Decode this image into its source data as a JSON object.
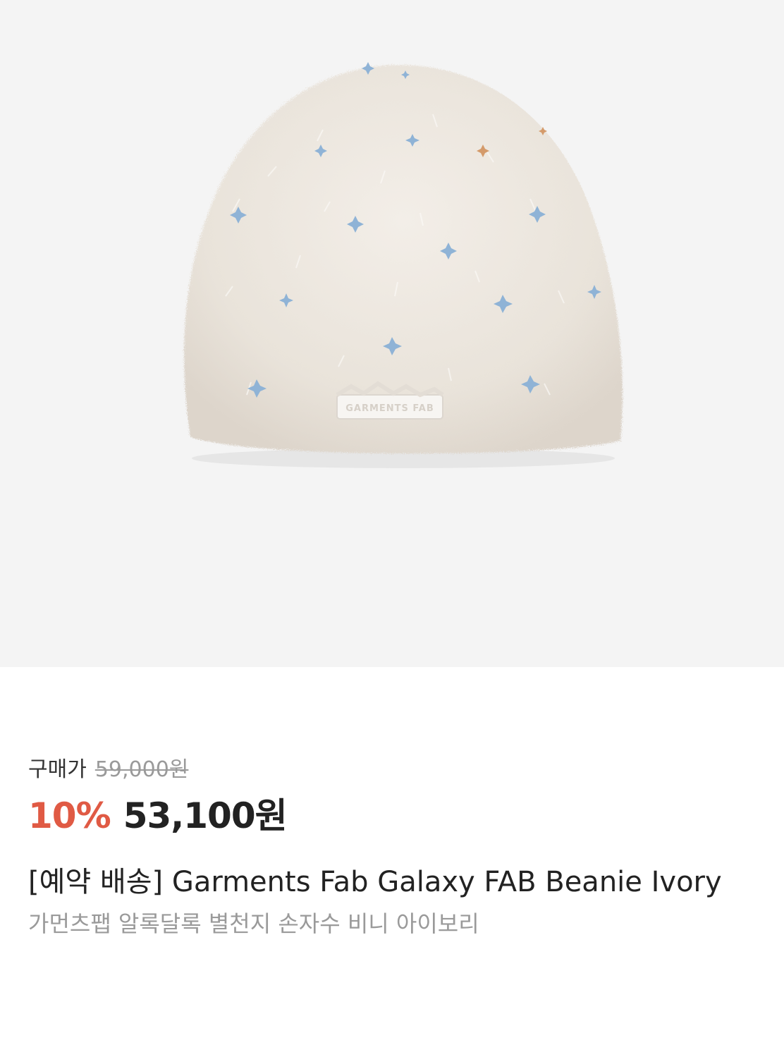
{
  "product": {
    "image_alt": "Garments Fab Galaxy FAB Beanie Ivory",
    "label_patch_text": "GARMENTS FAB",
    "price_label": "구매가",
    "original_price": "59,000원",
    "discount": "10%",
    "sale_price": "53,100원",
    "title": "[예약 배송] Garments Fab Galaxy FAB Beanie Ivory",
    "subtitle": "가먼츠팹 알록달록 별천지 손자수 비니 아이보리"
  },
  "colors": {
    "image_background": "#f4f4f4",
    "discount": "#e05a44",
    "beanie": "#ede7df",
    "stars": "#8fb3d6"
  }
}
